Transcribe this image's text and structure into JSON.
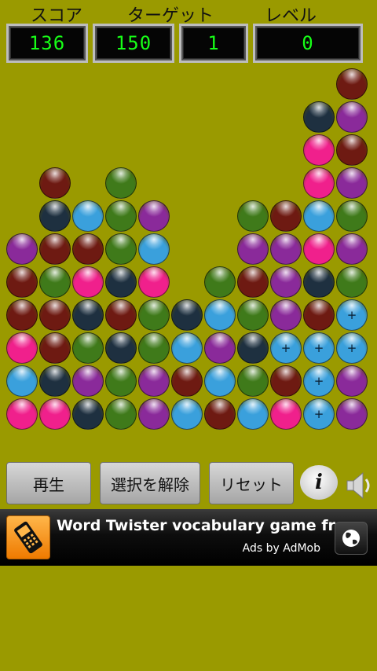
{
  "header": {
    "score_label": "スコア",
    "target_label": "ターゲット",
    "level_label": "レベル",
    "score": "136",
    "target": "150",
    "moves": "1",
    "level": "0"
  },
  "colors": {
    "background": "#9a9a00",
    "R": "#6e1a12",
    "G": "#3f7a1a",
    "B": "#3aa0dc",
    "N": "#1e3040",
    "P": "#8a2a9a",
    "K": "#f0208c",
    "digits": "#17ff17"
  },
  "board": {
    "rows": [
      "..........R",
      ".........NP",
      ".........KR",
      ".R.G.....KP",
      ".NBGP..GRBG",
      "PRRGB..PPKP",
      "RGKNK.GRPNG",
      "RRNRGNBGPRb",
      "KRGNGBPNbbb",
      "BNPGPRBGRbP",
      "KKNGPBRBKbP"
    ],
    "legend": {
      "R": "dark-red",
      "G": "green",
      "B": "light-blue",
      "N": "navy",
      "P": "purple",
      "K": "pink",
      "b": "light-blue-selected"
    },
    "selected_mark": "+"
  },
  "buttons": {
    "play": "再生",
    "deselect": "選択を解除",
    "reset": "リセット",
    "info_glyph": "i"
  },
  "ad": {
    "title": "Word Twister vocabulary game free",
    "subtitle": "Ads by AdMob"
  },
  "icons": {
    "info": "info-icon",
    "sound": "speaker-icon",
    "ad_app": "phone-icon",
    "ad_link": "globe-icon"
  }
}
